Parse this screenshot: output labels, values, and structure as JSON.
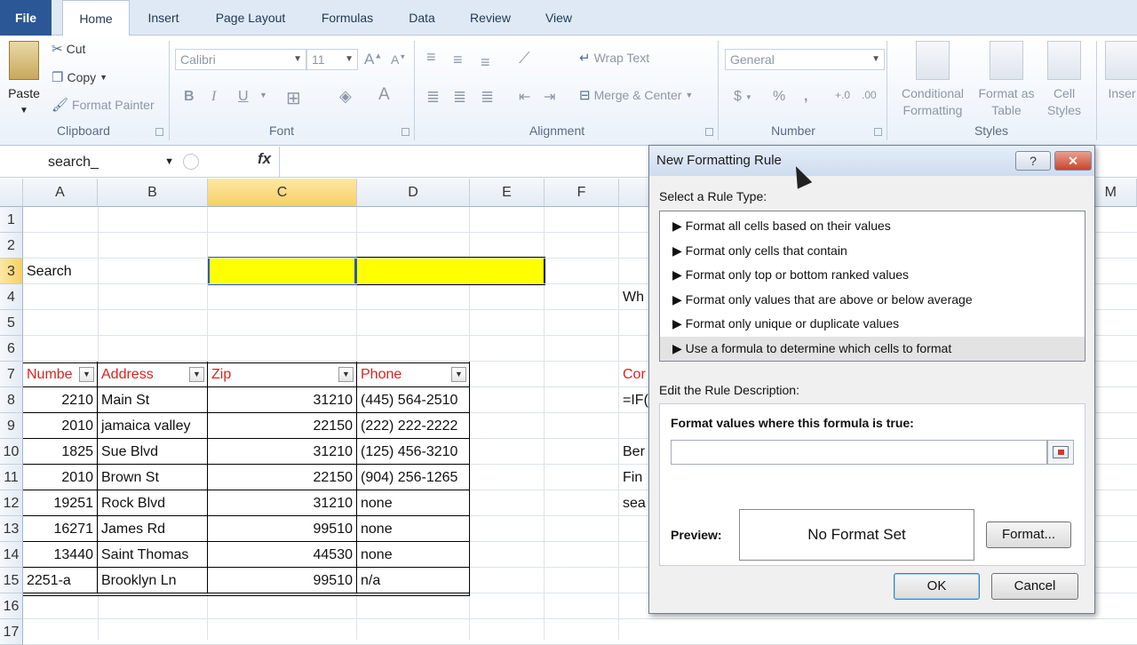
{
  "ribbon_tabs": [
    "File",
    "Home",
    "Insert",
    "Page Layout",
    "Formulas",
    "Data",
    "Review",
    "View"
  ],
  "clipboard": {
    "paste": "Paste",
    "cut": "Cut",
    "copy": "Copy",
    "format_painter": "Format Painter",
    "label": "Clipboard"
  },
  "font": {
    "name": "Calibri",
    "size": "11",
    "bold": "B",
    "italic": "I",
    "underline": "U",
    "label": "Font"
  },
  "alignment": {
    "wrap_text": "Wrap Text",
    "merge_center": "Merge & Center",
    "label": "Alignment"
  },
  "number": {
    "format": "General",
    "currency": "$",
    "percent": "%",
    "comma": ",",
    "label": "Number"
  },
  "styles": {
    "conditional_formatting": "Conditional Formatting",
    "format_as_table": "Format as Table",
    "cell_styles": "Cell Styles",
    "label": "Styles"
  },
  "cells_group": {
    "insert": "Inser"
  },
  "formula_bar": {
    "name_box": "search_",
    "fx": "fx"
  },
  "columns": [
    "A",
    "B",
    "C",
    "D",
    "E",
    "F",
    "M"
  ],
  "rows": [
    "1",
    "2",
    "3",
    "4",
    "5",
    "6",
    "7",
    "8",
    "9",
    "10",
    "11",
    "12",
    "13",
    "14",
    "15",
    "16",
    "17"
  ],
  "sheet": {
    "search_label": "Search",
    "headers": [
      "Numbe",
      "Address",
      "Zip",
      "Phone"
    ],
    "data": [
      [
        "2210",
        "Main St",
        "31210",
        "(445) 564-2510"
      ],
      [
        "2010",
        "jamaica valley",
        "22150",
        "(222) 222-2222"
      ],
      [
        "1825",
        "Sue Blvd",
        "31210",
        "(125) 456-3210"
      ],
      [
        "2010",
        "Brown St",
        "22150",
        "(904) 256-1265"
      ],
      [
        "19251",
        "Rock Blvd",
        "31210",
        "none"
      ],
      [
        "16271",
        "James Rd",
        "99510",
        "none"
      ],
      [
        "13440",
        "Saint Thomas",
        "44530",
        "none"
      ],
      [
        "2251-a",
        "Brooklyn Ln",
        "99510",
        "n/a"
      ]
    ],
    "side_text": {
      "r4": "Wh",
      "r7": "Cor",
      "r8": "=IF(",
      "r10": "Ber",
      "r11": "Fin",
      "r12": "sea"
    }
  },
  "dialog": {
    "title": "New Formatting Rule",
    "help": "?",
    "close": "✕",
    "select_rule_type": "Select a Rule Type:",
    "rule_types": [
      "Format all cells based on their values",
      "Format only cells that contain",
      "Format only top or bottom ranked values",
      "Format only values that are above or below average",
      "Format only unique or duplicate values",
      "Use a formula to determine which cells to format"
    ],
    "selected_rule_index": 5,
    "edit_description": "Edit the Rule Description:",
    "formula_label": "Format values where this formula is true:",
    "formula_value": "",
    "preview_label": "Preview:",
    "preview_text": "No Format Set",
    "format_button": "Format...",
    "ok_button": "OK",
    "cancel_button": "Cancel"
  },
  "colors": {
    "highlight_yellow": "#ffff00",
    "header_red": "#e02020",
    "selected_col": "#f8cf63"
  }
}
